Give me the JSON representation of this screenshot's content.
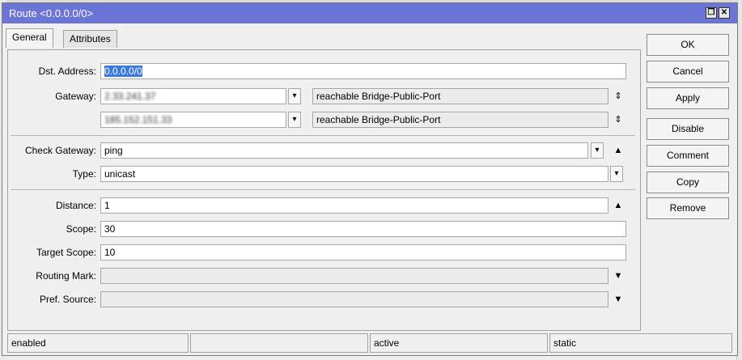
{
  "window": {
    "title": "Route <0.0.0.0/0>"
  },
  "titlebar_buttons": {
    "restore": "❐",
    "close": "✕"
  },
  "tabs": [
    {
      "label": "General"
    },
    {
      "label": "Attributes"
    }
  ],
  "form": {
    "dst_address": {
      "label": "Dst. Address:",
      "value": "0.0.0.0/0"
    },
    "gateway": {
      "label": "Gateway:",
      "rows": [
        {
          "value": "2.33.241.37",
          "status": "reachable Bridge-Public-Port"
        },
        {
          "value": "185.152.151.33",
          "status": "reachable Bridge-Public-Port"
        }
      ]
    },
    "check_gateway": {
      "label": "Check Gateway:",
      "value": "ping"
    },
    "type": {
      "label": "Type:",
      "value": "unicast"
    },
    "distance": {
      "label": "Distance:",
      "value": "1"
    },
    "scope": {
      "label": "Scope:",
      "value": "30"
    },
    "target_scope": {
      "label": "Target Scope:",
      "value": "10"
    },
    "routing_mark": {
      "label": "Routing Mark:",
      "value": ""
    },
    "pref_source": {
      "label": "Pref. Source:",
      "value": ""
    }
  },
  "buttons": {
    "ok": "OK",
    "cancel": "Cancel",
    "apply": "Apply",
    "disable": "Disable",
    "comment": "Comment",
    "copy": "Copy",
    "remove": "Remove"
  },
  "statusbar": {
    "state": "enabled",
    "empty": "",
    "activity": "active",
    "kind": "static"
  },
  "icons": {
    "dropdown": "dropdown-icon",
    "updown": "up-down-arrow-icon",
    "up": "up-arrow-icon",
    "down": "down-arrow-icon"
  },
  "colors": {
    "titlebar": "#6a75d6",
    "selection": "#3979e0"
  }
}
